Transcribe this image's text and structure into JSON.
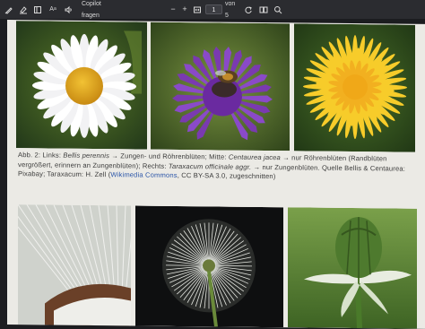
{
  "toolbar": {
    "copilot_label": "Copilot fragen",
    "page_number": "1",
    "page_of": "von 5",
    "zoom_in": "+",
    "zoom_out": "−",
    "draw_label": "A"
  },
  "caption": {
    "abb": "Abb. 2: Links: ",
    "bellis": "Bellis perennis",
    "part1": " → Zungen- und Röhrenblüten; Mitte: ",
    "centaurea": "Centaurea jacea",
    "part2": " → nur Röhrenblüten (Randblüten vergrößert, erinnern an Zungenblüten); Rechts: ",
    "taraxacum": "Taraxacum officinale aggr.",
    "part3": " → nur Zungenblüten. Quelle Bellis & Centaurea: Pixabay; Taraxacum: H. Zell (",
    "link": "Wikimedia Commons",
    "part4": ", CC BY-SA 3.0, zugeschnitten)"
  },
  "photos": {
    "top": [
      "daisy-photo",
      "knapweed-photo",
      "dandelion-flower-photo"
    ],
    "bottom": [
      "dandelion-seed-detail-photo",
      "dandelion-clock-photo",
      "dandelion-bud-photo"
    ]
  },
  "colors": {
    "toolbar": "#2b2c30",
    "page": "#ebeae5",
    "link": "#2a55a8"
  }
}
